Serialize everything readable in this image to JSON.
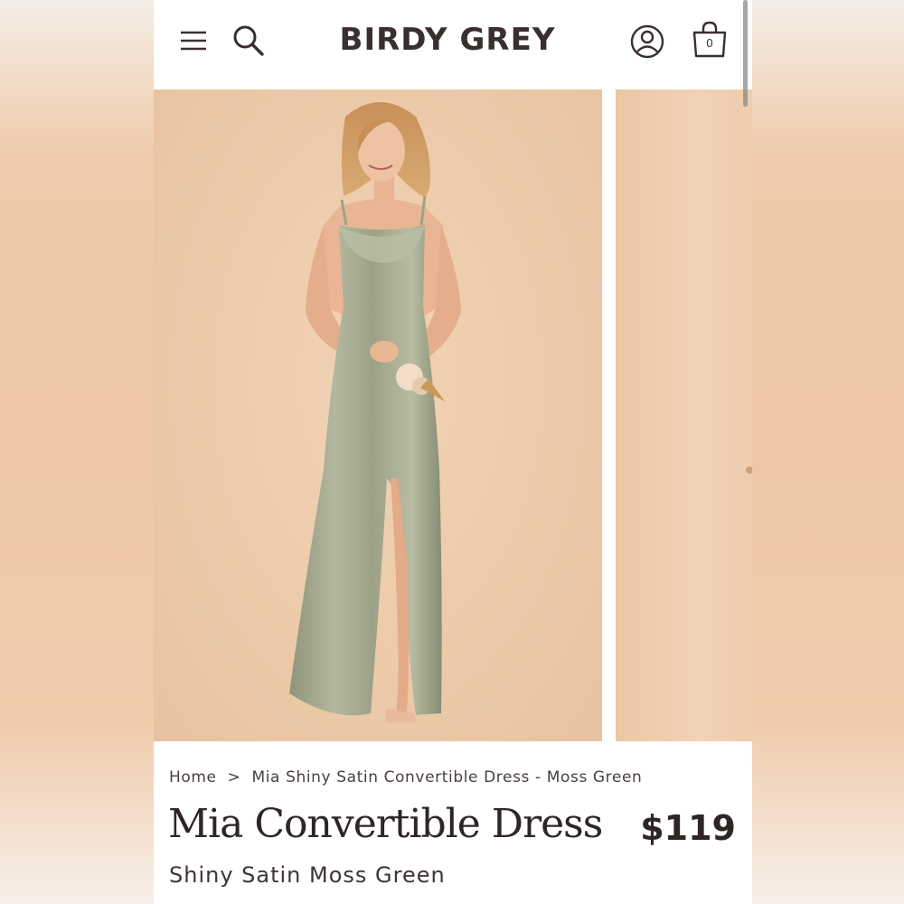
{
  "header": {
    "logo": "BIRDY GREY",
    "menu_icon": "hamburger-menu-icon",
    "search_icon": "search-icon",
    "account_icon": "account-icon",
    "bag_icon": "shopping-bag-icon",
    "bag_count": "0"
  },
  "gallery": {
    "main_image": "model-in-moss-green-satin-dress",
    "next_image": "next-product-image-partial"
  },
  "breadcrumb": {
    "home": "Home",
    "separator": ">",
    "current": "Mia Shiny Satin Convertible Dress - Moss Green"
  },
  "product": {
    "title": "Mia Convertible Dress",
    "price": "$119",
    "subtitle": "Shiny Satin Moss Green"
  },
  "colors": {
    "brand_text": "#3a2f2f",
    "background_peach": "#eccaa9",
    "dress_moss_green": "#a3a88d"
  }
}
